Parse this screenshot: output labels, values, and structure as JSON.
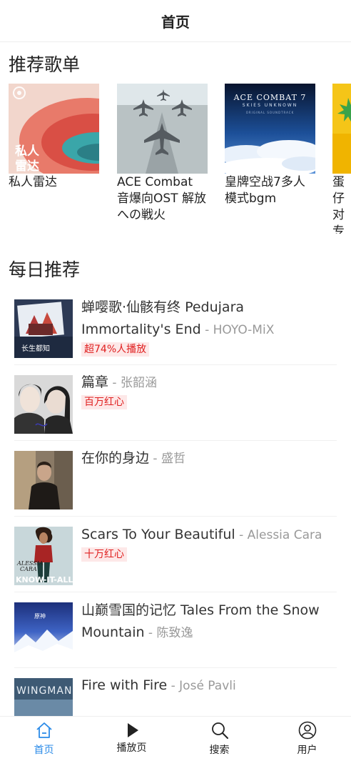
{
  "header": {
    "title": "首页"
  },
  "playlists": {
    "title": "推荐歌单",
    "items": [
      {
        "name": "私人雷达",
        "cover_text_line1": "私人",
        "cover_text_line2": "雷达"
      },
      {
        "name": "ACE Combat 音爆向OST 解放への戦火"
      },
      {
        "name": "皇牌空战7多人模式bgm",
        "cover_text_line1": "ACE COMBAT 7",
        "cover_text_line2": "SKIES UNKNOWN",
        "cover_text_line3": "ORIGINAL SOUNDTRACK"
      },
      {
        "name": "蛋仔对专"
      }
    ]
  },
  "daily": {
    "title": "每日推荐",
    "songs": [
      {
        "title": "蝉嘤歌·仙骸有终 Pedujara Immortality's End",
        "sep": " - ",
        "artist": "HOYO-MiX",
        "badge": "超74%人播放"
      },
      {
        "title": "篇章",
        "sep": " - ",
        "artist": "张韶涵",
        "badge": "百万红心"
      },
      {
        "title": "在你的身边",
        "sep": " - ",
        "artist": "盛哲",
        "badge": ""
      },
      {
        "title": "Scars To Your Beautiful",
        "sep": " - ",
        "artist": "Alessia Cara",
        "badge": "十万红心"
      },
      {
        "title": "山巅雪国的记忆 Tales From the Snow Mountain",
        "sep": " - ",
        "artist": "陈致逸",
        "badge": ""
      },
      {
        "title": "Fire with Fire",
        "sep": " - ",
        "artist": "José Pavli",
        "badge": ""
      }
    ]
  },
  "tabbar": {
    "items": [
      {
        "label": "首页",
        "icon": "home-icon",
        "active": true
      },
      {
        "label": "播放页",
        "icon": "play-icon",
        "active": false
      },
      {
        "label": "搜索",
        "icon": "search-icon",
        "active": false
      },
      {
        "label": "用户",
        "icon": "user-icon",
        "active": false
      }
    ]
  },
  "colors": {
    "accent": "#2b8be8",
    "badge_text": "#e02020",
    "badge_bg": "#fde8e8"
  }
}
